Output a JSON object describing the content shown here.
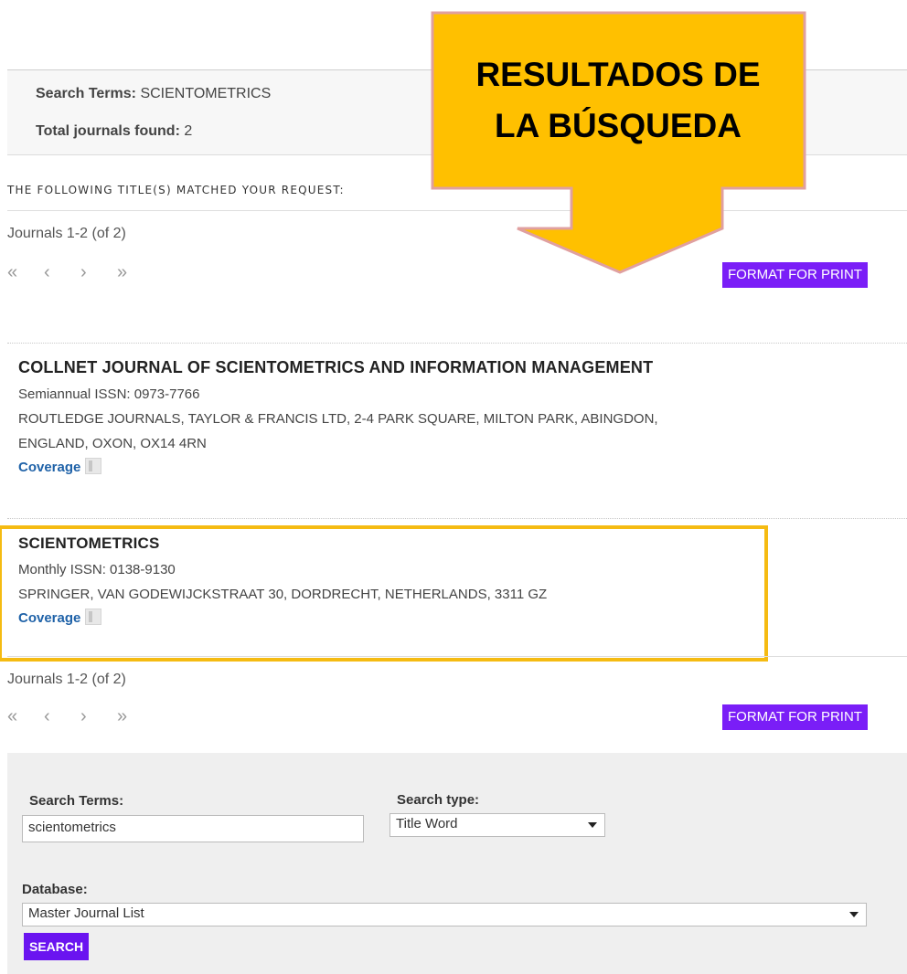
{
  "summary": {
    "search_terms_label": "Search Terms:",
    "search_terms_value": "SCIENTOMETRICS",
    "total_label": "Total journals found:",
    "total_value": "2"
  },
  "matched_heading": "THE FOLLOWING TITLE(S) MATCHED YOUR REQUEST:",
  "pagination": {
    "info": "Journals 1-2 (of 2)",
    "first": "«",
    "prev": "‹",
    "next": "›",
    "last": "»"
  },
  "format_for_print": "FORMAT FOR PRINT",
  "results": [
    {
      "title": "COLLNET JOURNAL OF SCIENTOMETRICS AND INFORMATION MANAGEMENT",
      "frequency_issn": "Semiannual ISSN: 0973-7766",
      "publisher_line1": "ROUTLEDGE JOURNALS, TAYLOR & FRANCIS LTD, 2-4 PARK SQUARE, MILTON PARK, ABINGDON,",
      "publisher_line2": "ENGLAND, OXON, OX14 4RN",
      "coverage": "Coverage"
    },
    {
      "title": "SCIENTOMETRICS",
      "frequency_issn": "Monthly ISSN: 0138-9130",
      "publisher_line1": "SPRINGER, VAN GODEWIJCKSTRAAT 30, DORDRECHT, NETHERLANDS, 3311 GZ",
      "coverage": "Coverage"
    }
  ],
  "callout": {
    "line1": "RESULTADOS DE",
    "line2": "LA BÚSQUEDA",
    "fill": "#ffc000",
    "border": "#e0a0a0"
  },
  "search_form": {
    "terms_label": "Search Terms:",
    "terms_value": "scientometrics",
    "type_label": "Search type:",
    "type_value": "Title Word",
    "database_label": "Database:",
    "database_value": "Master Journal List",
    "search_button": "SEARCH"
  },
  "colors": {
    "accent": "#7a1ef7",
    "link": "#1f62a8",
    "highlight": "#f5bb12"
  }
}
